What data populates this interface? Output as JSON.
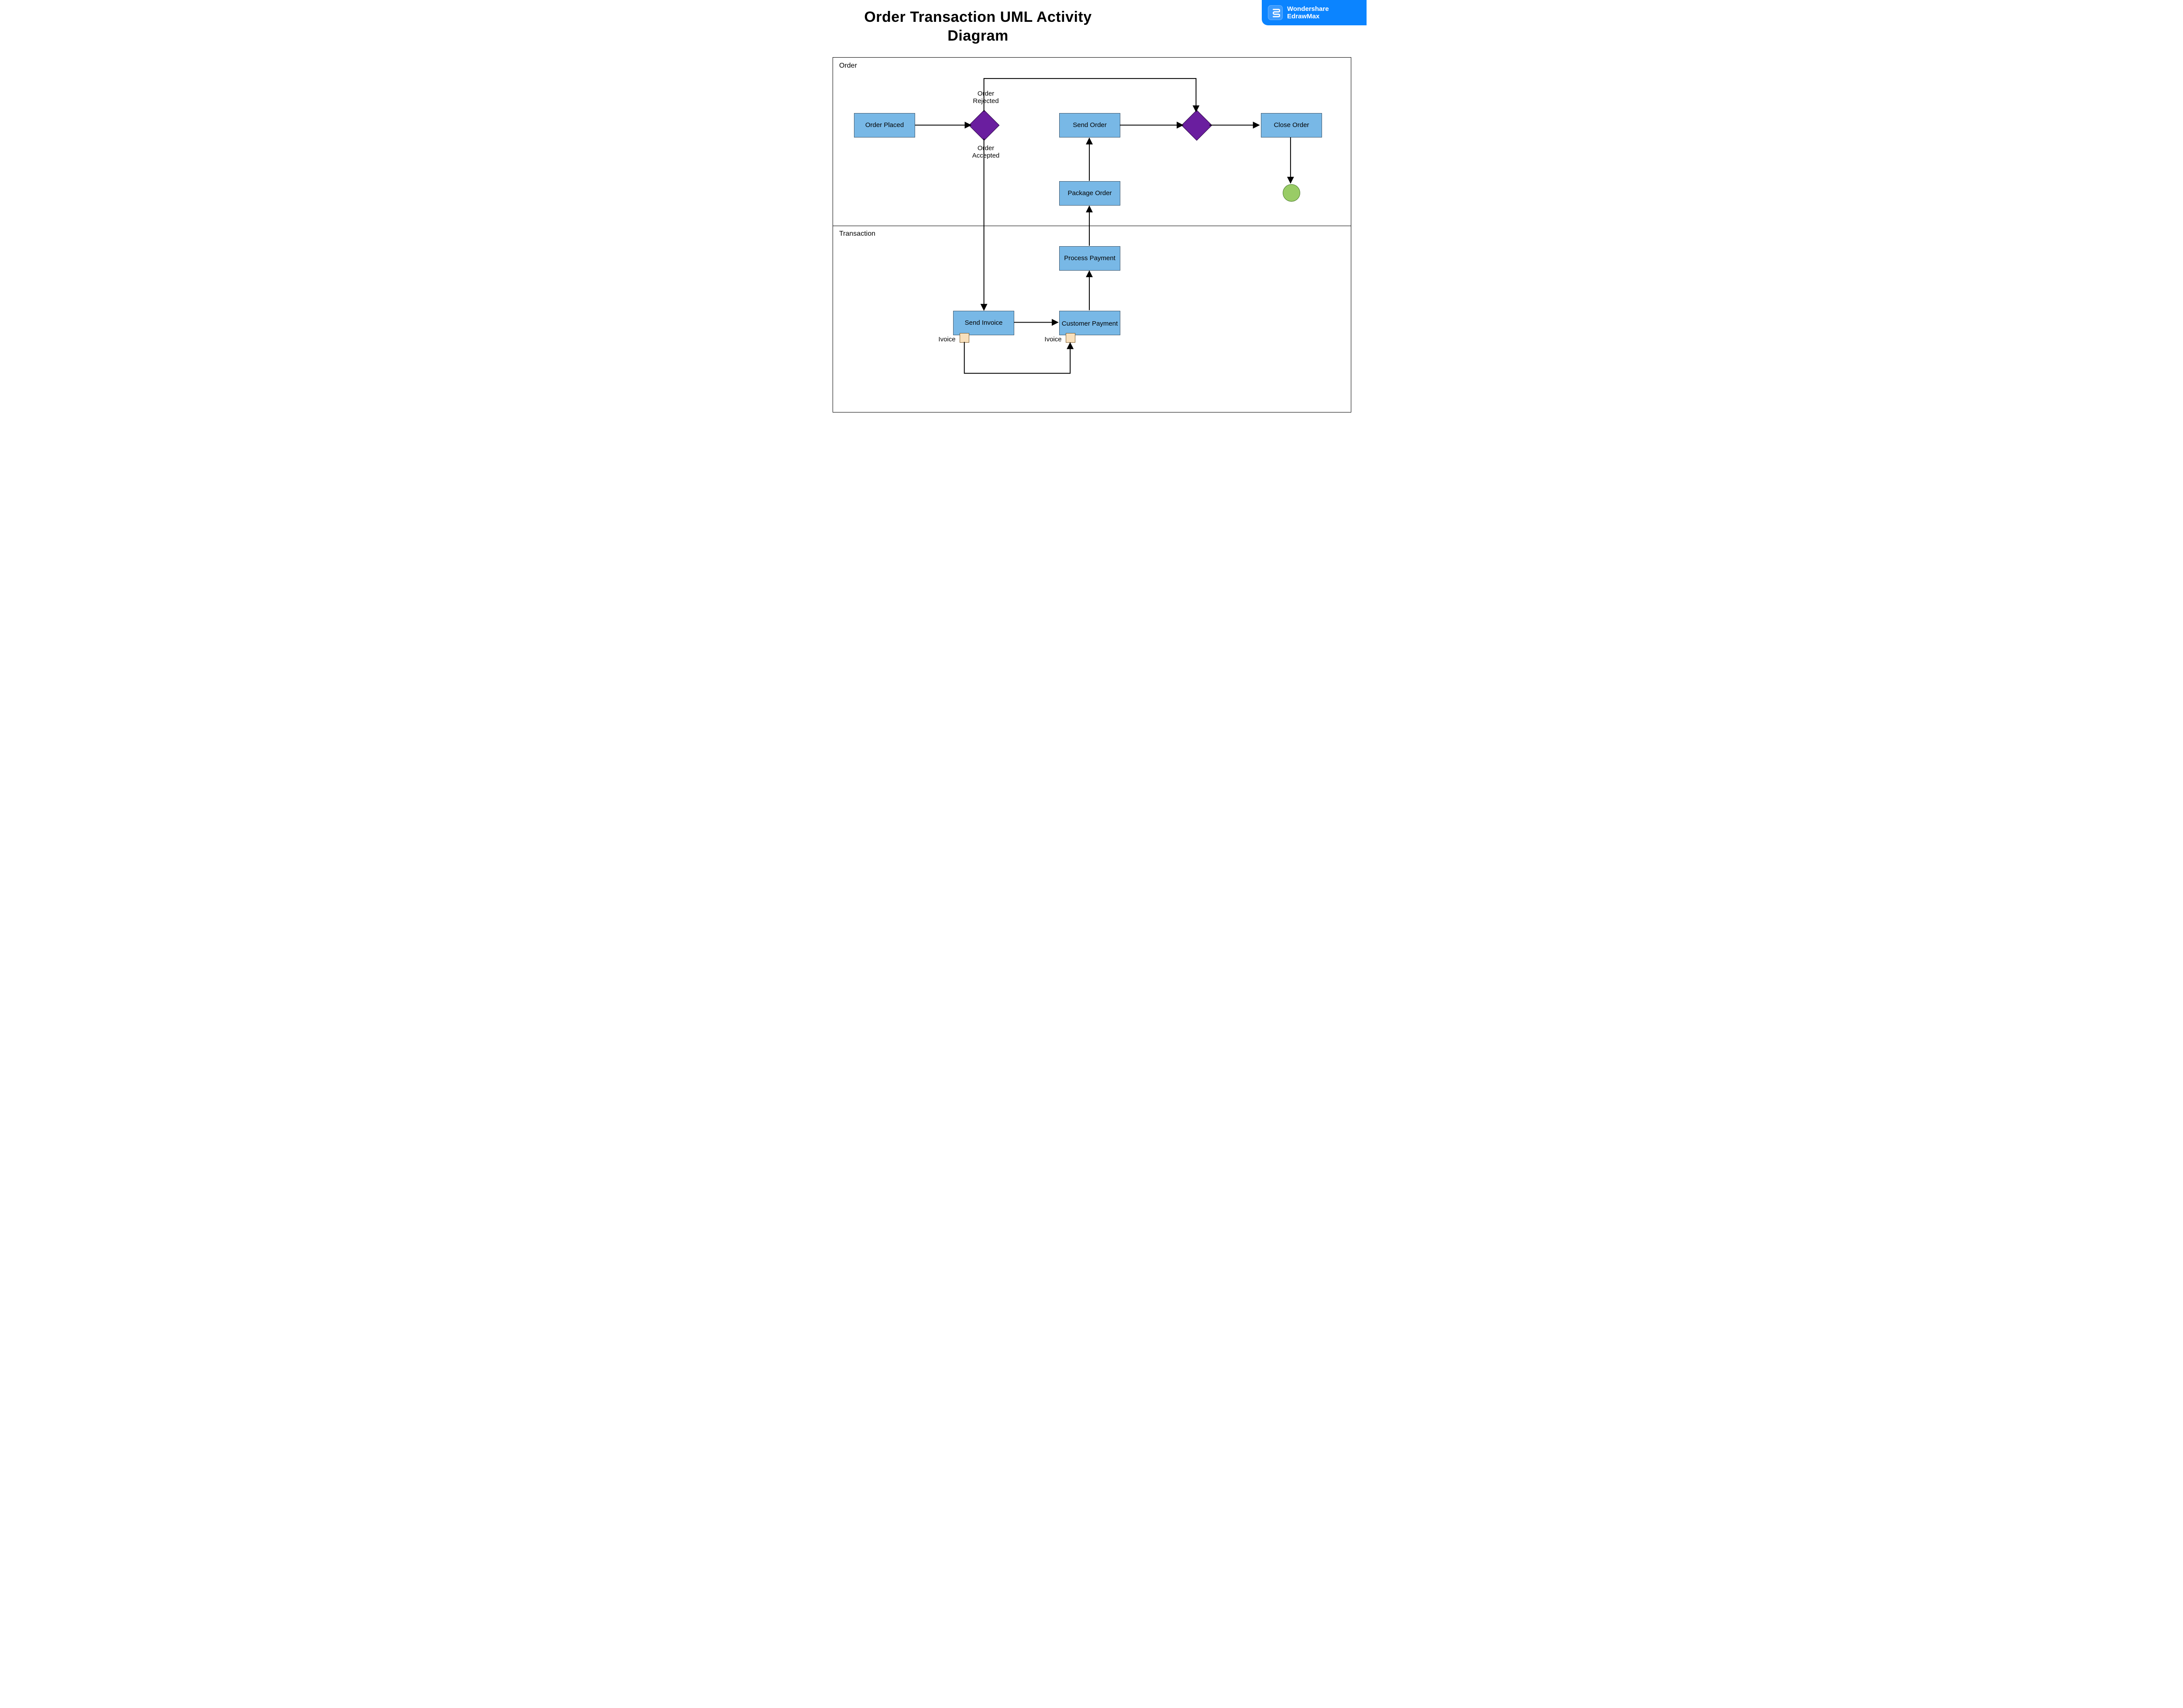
{
  "title": "Order Transaction UML Activity Diagram",
  "brand": {
    "line1": "Wondershare",
    "line2": "EdrawMax"
  },
  "lanes": {
    "order": "Order",
    "transaction": "Transaction"
  },
  "nodes": {
    "order_placed": "Order Placed",
    "send_order": "Send Order",
    "close_order": "Close Order",
    "package_order": "Package Order",
    "process_payment": "Process Payment",
    "send_invoice": "Send Invoice",
    "customer_payment": "Customer Payment"
  },
  "decision_labels": {
    "rejected": "Order Rejected",
    "accepted": "Order Accepted"
  },
  "pins": {
    "invoice_left": "Ivoice",
    "invoice_right": "Ivoice"
  },
  "colors": {
    "activity_fill": "#78b8e6",
    "decision_fill": "#6a1e9f",
    "final_fill": "#99cc66",
    "pin_fill": "#f8e0bc",
    "brand_bg": "#0b84ff"
  },
  "chart_data": {
    "type": "uml-activity",
    "title": "Order Transaction UML Activity Diagram",
    "swimlanes": [
      "Order",
      "Transaction"
    ],
    "nodes": [
      {
        "id": "order_placed",
        "kind": "activity",
        "lane": "Order",
        "label": "Order Placed"
      },
      {
        "id": "decision1",
        "kind": "decision",
        "lane": "Order",
        "label": ""
      },
      {
        "id": "send_order",
        "kind": "activity",
        "lane": "Order",
        "label": "Send Order"
      },
      {
        "id": "merge1",
        "kind": "merge",
        "lane": "Order",
        "label": ""
      },
      {
        "id": "close_order",
        "kind": "activity",
        "lane": "Order",
        "label": "Close Order"
      },
      {
        "id": "final",
        "kind": "final",
        "lane": "Order",
        "label": ""
      },
      {
        "id": "package_order",
        "kind": "activity",
        "lane": "Order",
        "label": "Package Order"
      },
      {
        "id": "send_invoice",
        "kind": "activity",
        "lane": "Transaction",
        "label": "Send Invoice"
      },
      {
        "id": "customer_payment",
        "kind": "activity",
        "lane": "Transaction",
        "label": "Customer Payment"
      },
      {
        "id": "process_payment",
        "kind": "activity",
        "lane": "Transaction",
        "label": "Process Payment"
      },
      {
        "id": "pin_invoice_out",
        "kind": "object-pin",
        "lane": "Transaction",
        "label": "Ivoice"
      },
      {
        "id": "pin_invoice_in",
        "kind": "object-pin",
        "lane": "Transaction",
        "label": "Ivoice"
      }
    ],
    "edges": [
      {
        "from": "order_placed",
        "to": "decision1"
      },
      {
        "from": "decision1",
        "to": "merge1",
        "guard": "Order Rejected"
      },
      {
        "from": "decision1",
        "to": "send_invoice",
        "guard": "Order Accepted"
      },
      {
        "from": "send_invoice",
        "to": "customer_payment"
      },
      {
        "from": "customer_payment",
        "to": "process_payment"
      },
      {
        "from": "process_payment",
        "to": "package_order"
      },
      {
        "from": "package_order",
        "to": "send_order"
      },
      {
        "from": "send_order",
        "to": "merge1"
      },
      {
        "from": "merge1",
        "to": "close_order"
      },
      {
        "from": "close_order",
        "to": "final"
      },
      {
        "from": "pin_invoice_out",
        "to": "pin_invoice_in",
        "kind": "object-flow"
      }
    ]
  }
}
